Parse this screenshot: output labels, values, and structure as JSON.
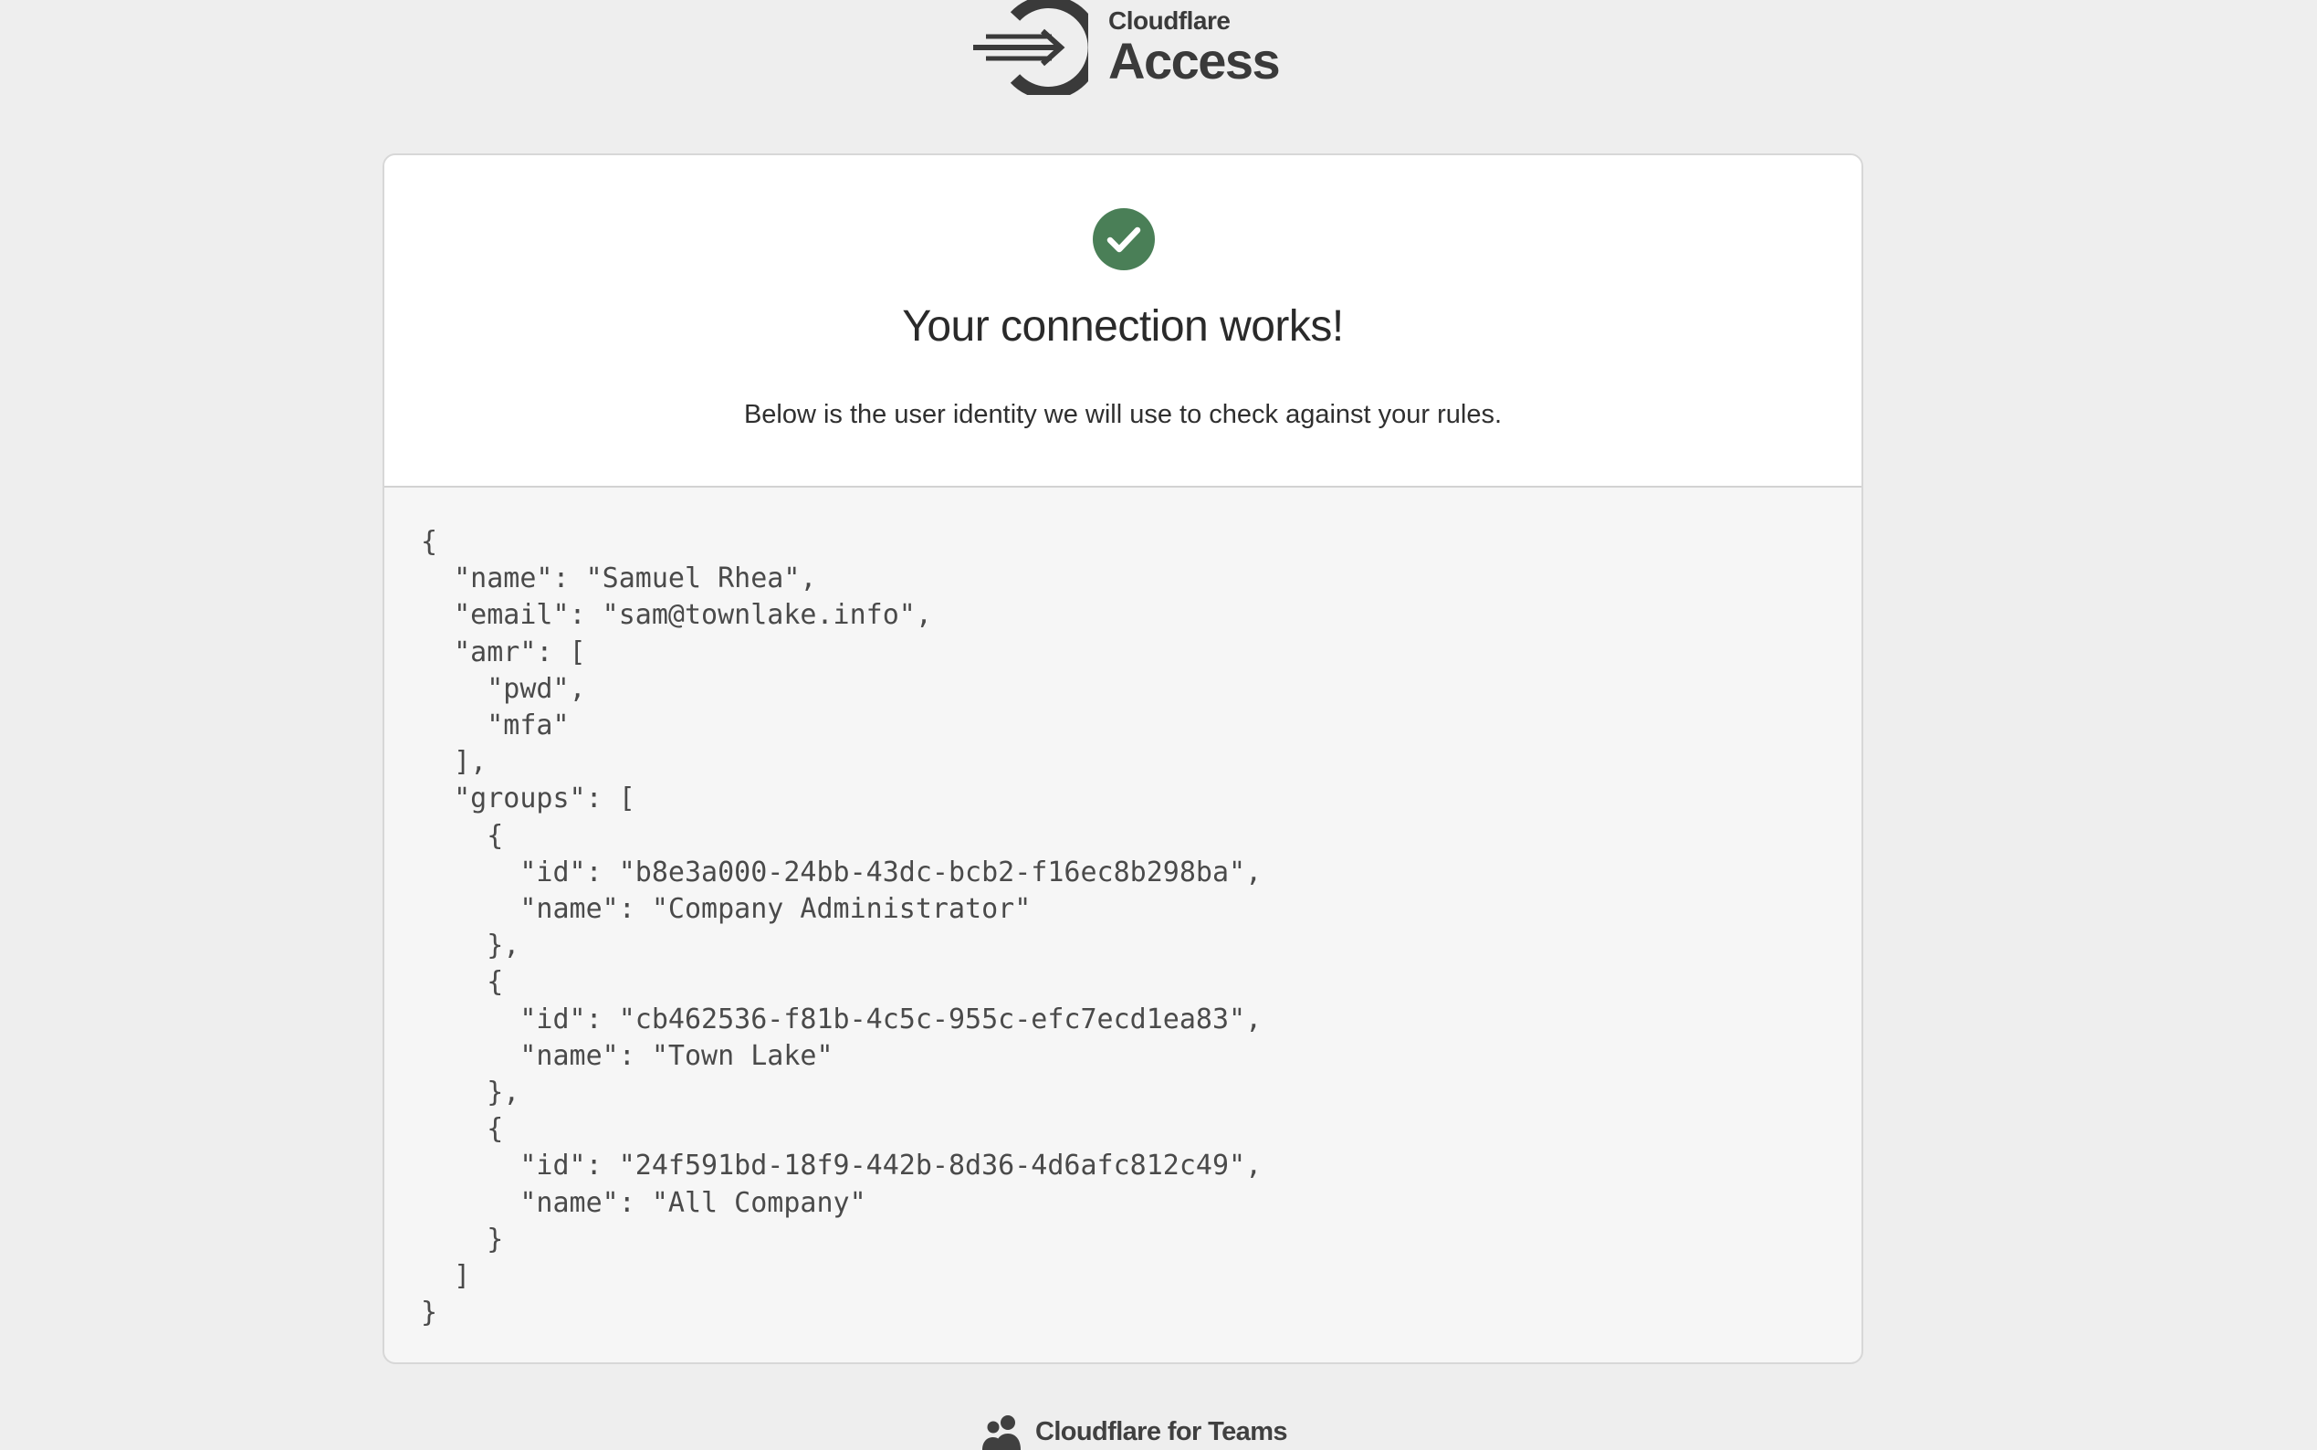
{
  "header": {
    "brand": "Cloudflare",
    "product": "Access"
  },
  "card": {
    "title": "Your connection works!",
    "subtitle": "Below is the user identity we will use to check against your rules.",
    "identity_json": "{\n  \"name\": \"Samuel Rhea\",\n  \"email\": \"sam@townlake.info\",\n  \"amr\": [\n    \"pwd\",\n    \"mfa\"\n  ],\n  \"groups\": [\n    {\n      \"id\": \"b8e3a000-24bb-43dc-bcb2-f16ec8b298ba\",\n      \"name\": \"Company Administrator\"\n    },\n    {\n      \"id\": \"cb462536-f81b-4c5c-955c-efc7ecd1ea83\",\n      \"name\": \"Town Lake\"\n    },\n    {\n      \"id\": \"24f591bd-18f9-442b-8d36-4d6afc812c49\",\n      \"name\": \"All Company\"\n    }\n  ]\n}"
  },
  "footer": {
    "label": "Cloudflare for Teams"
  },
  "colors": {
    "background": "#eeeeee",
    "success": "#4a7f57",
    "logo": "#3a3a3a"
  },
  "icons": {
    "logo": "cloudflare-access-logo-icon",
    "success": "check-circle-icon",
    "footer": "users-icon"
  }
}
